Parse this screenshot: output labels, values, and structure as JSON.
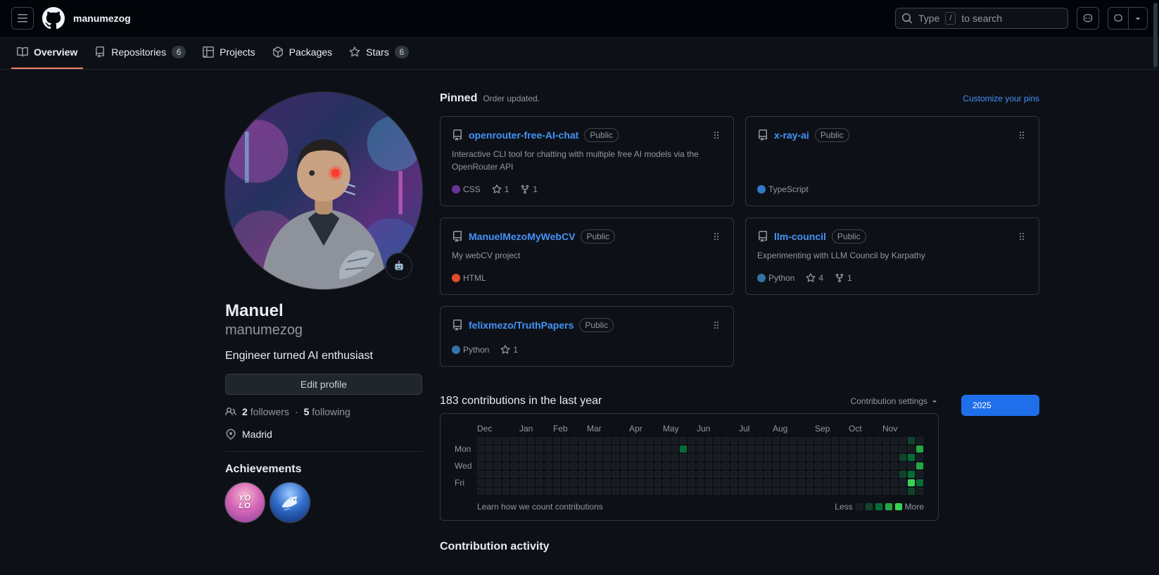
{
  "theme": {
    "page_bg": "#0d1117",
    "header_bg": "#010409",
    "border": "#30363d",
    "link": "#4493f8",
    "muted": "#9198a1",
    "tab_accent": "#f78166",
    "year_button_bg": "#1f6feb"
  },
  "header": {
    "username": "manumezog",
    "search_pre": "Type",
    "search_key": "/",
    "search_post": "to search"
  },
  "nav": {
    "tabs": [
      {
        "label": "Overview"
      },
      {
        "label": "Repositories",
        "count": "6"
      },
      {
        "label": "Projects"
      },
      {
        "label": "Packages"
      },
      {
        "label": "Stars",
        "count": "6"
      }
    ]
  },
  "profile": {
    "name": "Manuel",
    "username": "manumezog",
    "bio": "Engineer turned AI enthusiast",
    "edit_button": "Edit profile",
    "followers_count": "2",
    "followers_label": "followers",
    "separator": "·",
    "following_count": "5",
    "following_label": "following",
    "location": "Madrid",
    "achievements_title": "Achievements",
    "achievements": [
      {
        "name": "YOLO",
        "text_top": "YO",
        "text_bottom": "LO"
      },
      {
        "name": "Pull Shark"
      }
    ]
  },
  "pinned": {
    "title": "Pinned",
    "note": "Order updated.",
    "customize_link": "Customize your pins",
    "repos": [
      {
        "name": "openrouter-free-AI-chat",
        "visibility": "Public",
        "description": "Interactive CLI tool for chatting with multiple free AI models via the OpenRouter API",
        "language": "CSS",
        "language_color": "#663399",
        "stars": "1",
        "forks": "1"
      },
      {
        "name": "x-ray-ai",
        "visibility": "Public",
        "language": "TypeScript",
        "language_color": "#3178c6"
      },
      {
        "name": "ManuelMezoMyWebCV",
        "visibility": "Public",
        "description": "My webCV project",
        "language": "HTML",
        "language_color": "#e34c26"
      },
      {
        "name": "llm-council",
        "visibility": "Public",
        "description": "Experimenting with LLM Council by Karpathy",
        "language": "Python",
        "language_color": "#3572A5",
        "stars": "4",
        "forks": "1"
      },
      {
        "name": "felixmezo/TruthPapers",
        "visibility": "Public",
        "language": "Python",
        "language_color": "#3572A5",
        "stars": "1"
      }
    ]
  },
  "contributions": {
    "title": "183 contributions in the last year",
    "total": 183,
    "settings_label": "Contribution settings",
    "year": "2025",
    "learn_link": "Learn how we count contributions",
    "less": "Less",
    "more": "More",
    "weeks": 53,
    "months": [
      {
        "label": "Dec",
        "week": 0
      },
      {
        "label": "Jan",
        "week": 5
      },
      {
        "label": "Feb",
        "week": 9
      },
      {
        "label": "Mar",
        "week": 13
      },
      {
        "label": "Apr",
        "week": 18
      },
      {
        "label": "May",
        "week": 22
      },
      {
        "label": "Jun",
        "week": 26
      },
      {
        "label": "Jul",
        "week": 31
      },
      {
        "label": "Aug",
        "week": 35
      },
      {
        "label": "Sep",
        "week": 40
      },
      {
        "label": "Oct",
        "week": 44
      },
      {
        "label": "Nov",
        "week": 48
      }
    ],
    "day_labels": [
      {
        "row": 1,
        "label": "Mon"
      },
      {
        "row": 3,
        "label": "Wed"
      },
      {
        "row": 5,
        "label": "Fri"
      }
    ],
    "level_colors": [
      "#161b22",
      "#0e4429",
      "#006d32",
      "#26a641",
      "#39d353"
    ],
    "cells": [
      {
        "week": 24,
        "day": 1,
        "level": 2
      },
      {
        "week": 50,
        "day": 2,
        "level": 1
      },
      {
        "week": 50,
        "day": 4,
        "level": 1
      },
      {
        "week": 51,
        "day": 0,
        "level": 1
      },
      {
        "week": 51,
        "day": 2,
        "level": 2
      },
      {
        "week": 51,
        "day": 4,
        "level": 2
      },
      {
        "week": 51,
        "day": 5,
        "level": 4
      },
      {
        "week": 51,
        "day": 6,
        "level": 1
      },
      {
        "week": 52,
        "day": 1,
        "level": 3
      },
      {
        "week": 52,
        "day": 3,
        "level": 3
      },
      {
        "week": 52,
        "day": 5,
        "level": 2
      }
    ]
  },
  "activity": {
    "title": "Contribution activity"
  }
}
